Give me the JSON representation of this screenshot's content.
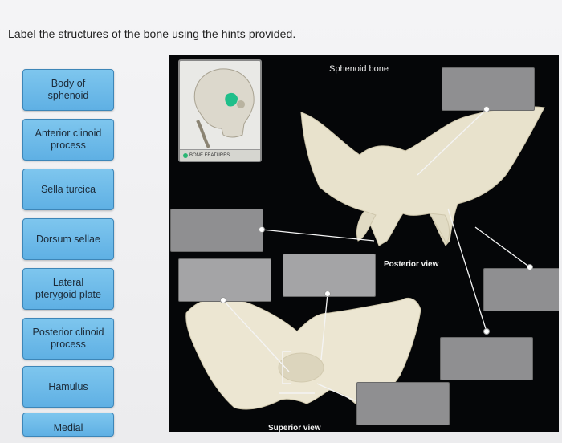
{
  "instruction": "Label the structures of the bone using the hints provided.",
  "label_bank": [
    "Body of\nsphenoid",
    "Anterior clinoid\nprocess",
    "Sella turcica",
    "Dorsum sellae",
    "Lateral\npterygoid plate",
    "Posterior clinoid\nprocess",
    "Hamulus",
    "Medial"
  ],
  "figure": {
    "title": "Sphenoid bone",
    "thumbnail_caption": "BONE FEATURES",
    "posterior_caption": "Posterior view",
    "superior_caption": "Superior view"
  },
  "colors": {
    "chip": "#6fbbe9",
    "chip_border": "#3d86b8",
    "panel_bg": "#050608",
    "drop_zone": "#8f8f91",
    "bone": "#e8e2cc",
    "highlight": "#1fbf8a"
  }
}
